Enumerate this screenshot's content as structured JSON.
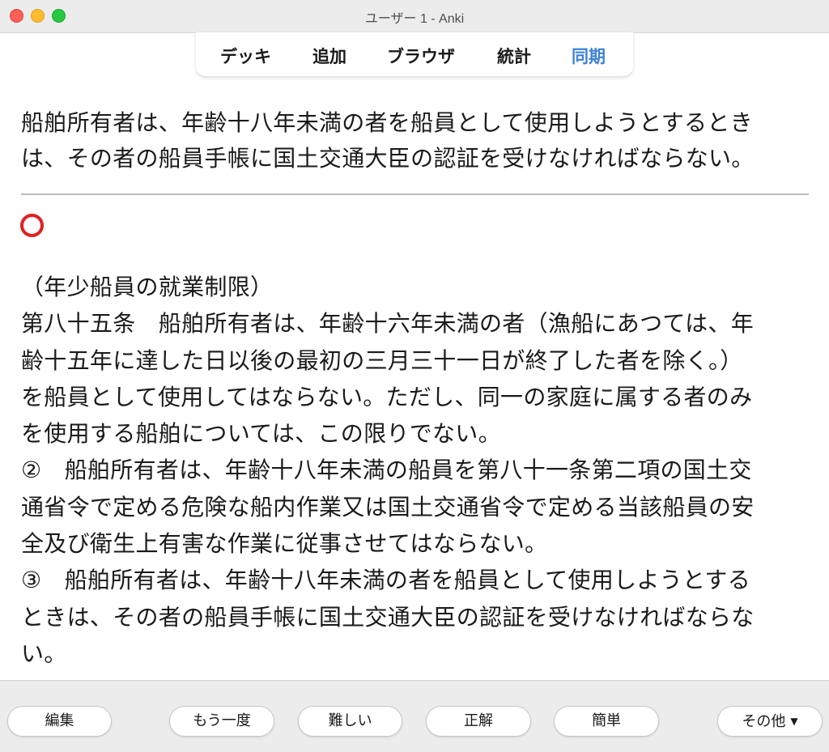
{
  "window": {
    "title": "ユーザー 1 - Anki"
  },
  "toolbar": {
    "items": [
      {
        "label": "デッキ"
      },
      {
        "label": "追加"
      },
      {
        "label": "ブラウザ"
      },
      {
        "label": "統計"
      },
      {
        "label": "同期",
        "active": true
      }
    ],
    "active_color": "#3b82d6"
  },
  "card": {
    "question_lines": [
      "船舶所有者は、年齢十八年未満の者を船員として使用しようとするとき",
      "は、その者の船員手帳に国土交通大臣の認証を受けなければならない。"
    ],
    "answer_mark": "red-circle-icon",
    "answer_lines": [
      "（年少船員の就業制限）",
      "第八十五条　船舶所有者は、年齢十六年未満の者（漁船にあつては、年",
      "齢十五年に達した日以後の最初の三月三十一日が終了した者を除く。）",
      "を船員として使用してはならない。ただし、同一の家庭に属する者のみ",
      "を使用する船舶については、この限りでない。",
      "②　船舶所有者は、年齢十八年未満の船員を第八十一条第二項の国土交",
      "通省令で定める危険な船内作業又は国土交通省令で定める当該船員の安",
      "全及び衛生上有害な作業に従事させてはならない。",
      "③　船舶所有者は、年齢十八年未満の者を船員として使用しようとする",
      "ときは、その者の船員手帳に国土交通大臣の認証を受けなければならな",
      "い。"
    ]
  },
  "bottom": {
    "edit": "編集",
    "again": "もう一度",
    "hard": "難しい",
    "good": "正解",
    "easy": "簡単",
    "more": "その他"
  },
  "colors": {
    "mark": "#e02020",
    "titlebar": "#ececec"
  }
}
